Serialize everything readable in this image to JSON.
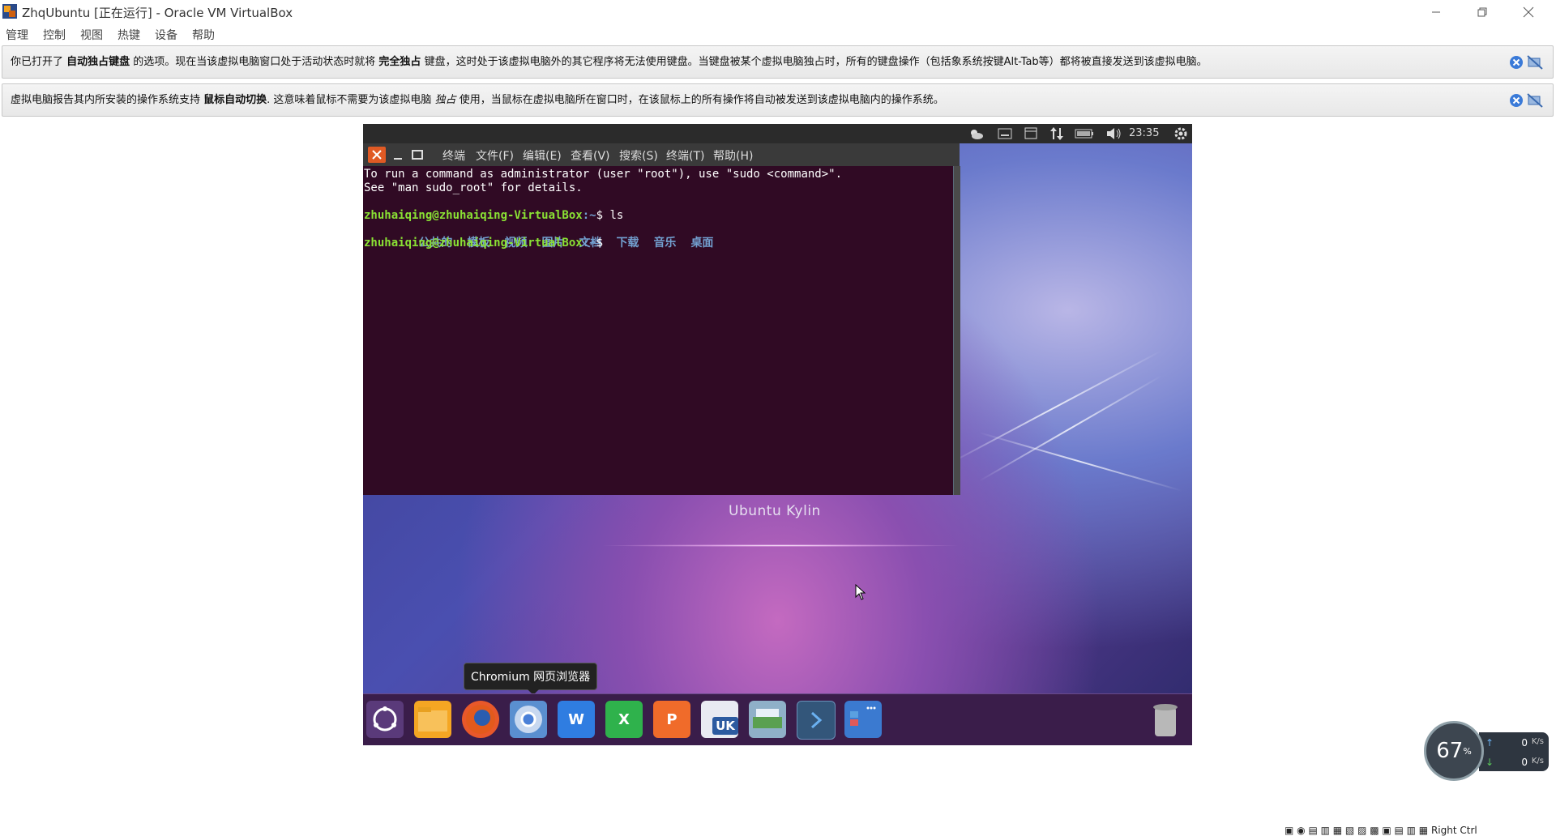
{
  "window": {
    "title": "ZhqUbuntu [正在运行] - Oracle VM VirtualBox"
  },
  "menubar": {
    "items": [
      "管理",
      "控制",
      "视图",
      "热键",
      "设备",
      "帮助"
    ]
  },
  "notices": [
    {
      "pre": "你已打开了 ",
      "b1": "自动独占键盘",
      "mid": " 的选项。现在当该虚拟电脑窗口处于活动状态时就将 ",
      "b2": "完全独占",
      "post": " 键盘，这时处于该虚拟电脑外的其它程序将无法使用键盘。当键盘被某个虚拟电脑独占时，所有的键盘操作（包括象系统按键Alt-Tab等）都将被直接发送到该虚拟电脑。"
    },
    {
      "pre": "虚拟电脑报告其内所安装的操作系统支持 ",
      "b1": "鼠标自动切换",
      "mid": ". 这意味着鼠标不需要为该虚拟电脑 ",
      "i1": "独占",
      "post": " 使用，当鼠标在虚拟电脑所在窗口时，在该鼠标上的所有操作将自动被发送到该虚拟电脑内的操作系统。"
    }
  ],
  "ubuntu": {
    "clock": "23:35",
    "wallpaper_label": "Ubuntu Kylin"
  },
  "terminal": {
    "menu": [
      "终端",
      "文件(F)",
      "编辑(E)",
      "查看(V)",
      "搜索(S)",
      "终端(T)",
      "帮助(H)"
    ],
    "line1": "To run a command as administrator (user \"root\"), use \"sudo <command>\".",
    "line2": "See \"man sudo_root\" for details.",
    "prompt_user": "zhuhaiqing@zhuhaiqing-VirtualBox",
    "prompt_path": ":~",
    "prompt_end": "$ ",
    "command": "ls",
    "dirs": [
      "公共的",
      "模板",
      "视频",
      "图片",
      "文档",
      "下载",
      "音乐",
      "桌面"
    ]
  },
  "tooltip": "Chromium 网页浏览器",
  "dock": {
    "items": [
      {
        "name": "ubuntu-kylin-icon",
        "color": "#5a3a7a"
      },
      {
        "name": "files-icon",
        "color": "#f5a623"
      },
      {
        "name": "firefox-icon",
        "color": "#e8582a"
      },
      {
        "name": "chromium-icon",
        "color": "#5a8fd0"
      },
      {
        "name": "wps-writer-icon",
        "color": "#2f7de1",
        "label": "W"
      },
      {
        "name": "wps-spreadsheet-icon",
        "color": "#2fb24c",
        "label": "X"
      },
      {
        "name": "wps-presentation-icon",
        "color": "#f06b2a",
        "label": "P"
      },
      {
        "name": "software-center-icon",
        "color": "#e9eaf2",
        "label": "UK"
      },
      {
        "name": "ubuntu-one-icon",
        "color": "#8fb0c8"
      },
      {
        "name": "terminal-icon",
        "color": "#33567a"
      },
      {
        "name": "workspace-switcher-icon",
        "color": "#3b7ad0"
      }
    ]
  },
  "net_widget": {
    "percent": "67",
    "percent_unit": "%",
    "up_value": "0",
    "down_value": "0",
    "unit": "K/s"
  },
  "statusbar": {
    "host_key": "Right Ctrl"
  }
}
